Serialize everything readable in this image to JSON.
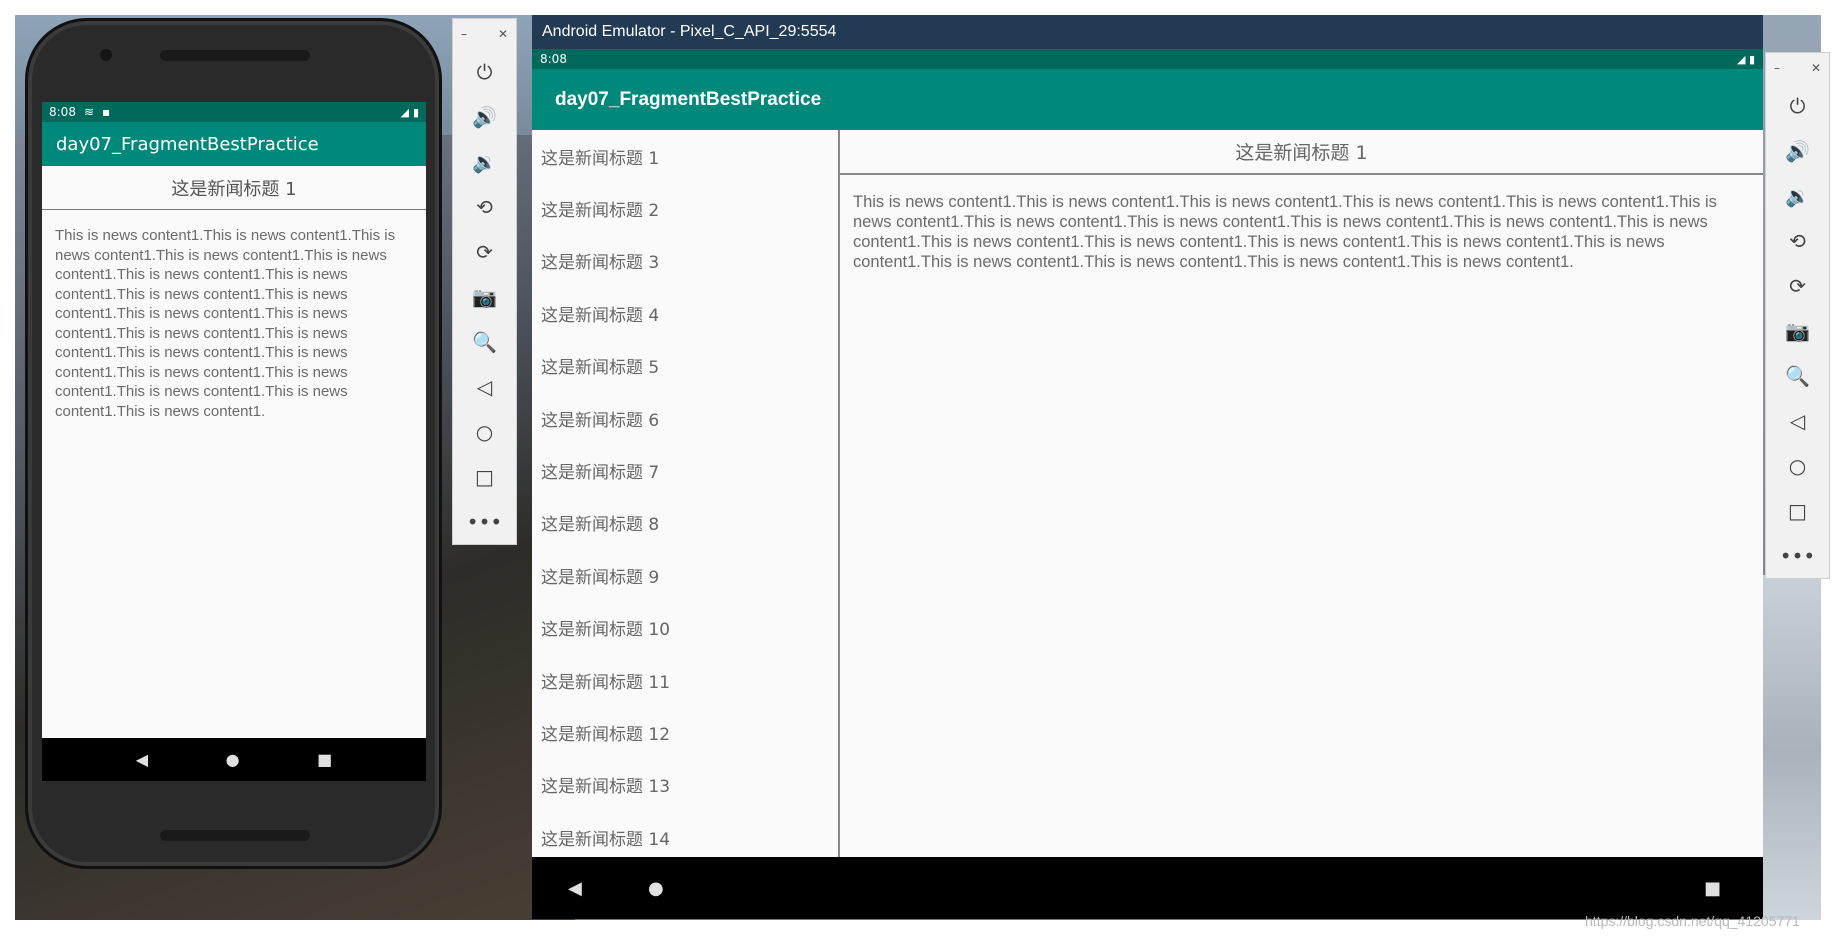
{
  "phone": {
    "status_time": "8:08",
    "app_title": "day07_FragmentBestPractice",
    "news_title": "这是新闻标题 1",
    "news_content": "This is news content1.This is news content1.This is news content1.This is news content1.This is news content1.This is news content1.This is news content1.This is news content1.This is news content1.This is news content1.This is news content1.This is news content1.This is news content1.This is news content1.This is news content1.This is news content1.This is news content1.This is news content1.This is news content1.This is news content1."
  },
  "emulator": {
    "window_title": "Android Emulator - Pixel_C_API_29:5554",
    "status_time": "8:08",
    "app_title": "day07_FragmentBestPractice",
    "news_list": [
      "这是新闻标题 1",
      "这是新闻标题 2",
      "这是新闻标题 3",
      "这是新闻标题 4",
      "这是新闻标题 5",
      "这是新闻标题 6",
      "这是新闻标题 7",
      "这是新闻标题 8",
      "这是新闻标题 9",
      "这是新闻标题 10",
      "这是新闻标题 11",
      "这是新闻标题 12",
      "这是新闻标题 13",
      "这是新闻标题 14"
    ],
    "news_title": "这是新闻标题 1",
    "news_content": "This is news content1.This is news content1.This is news content1.This is news content1.This is news content1.This is news content1.This is news content1.This is news content1.This is news content1.This is news content1.This is news content1.This is news content1.This is news content1.This is news content1.This is news content1.This is news content1.This is news content1.This is news content1.This is news content1.This is news content1."
  },
  "toolbar_icons": [
    "power-icon",
    "volume-up-icon",
    "volume-down-icon",
    "rotate-left-icon",
    "rotate-right-icon",
    "camera-icon",
    "zoom-icon",
    "back-icon",
    "home-icon",
    "overview-icon",
    "more-icon"
  ],
  "watermark": "https://blog.csdn.net/qq_41205771"
}
